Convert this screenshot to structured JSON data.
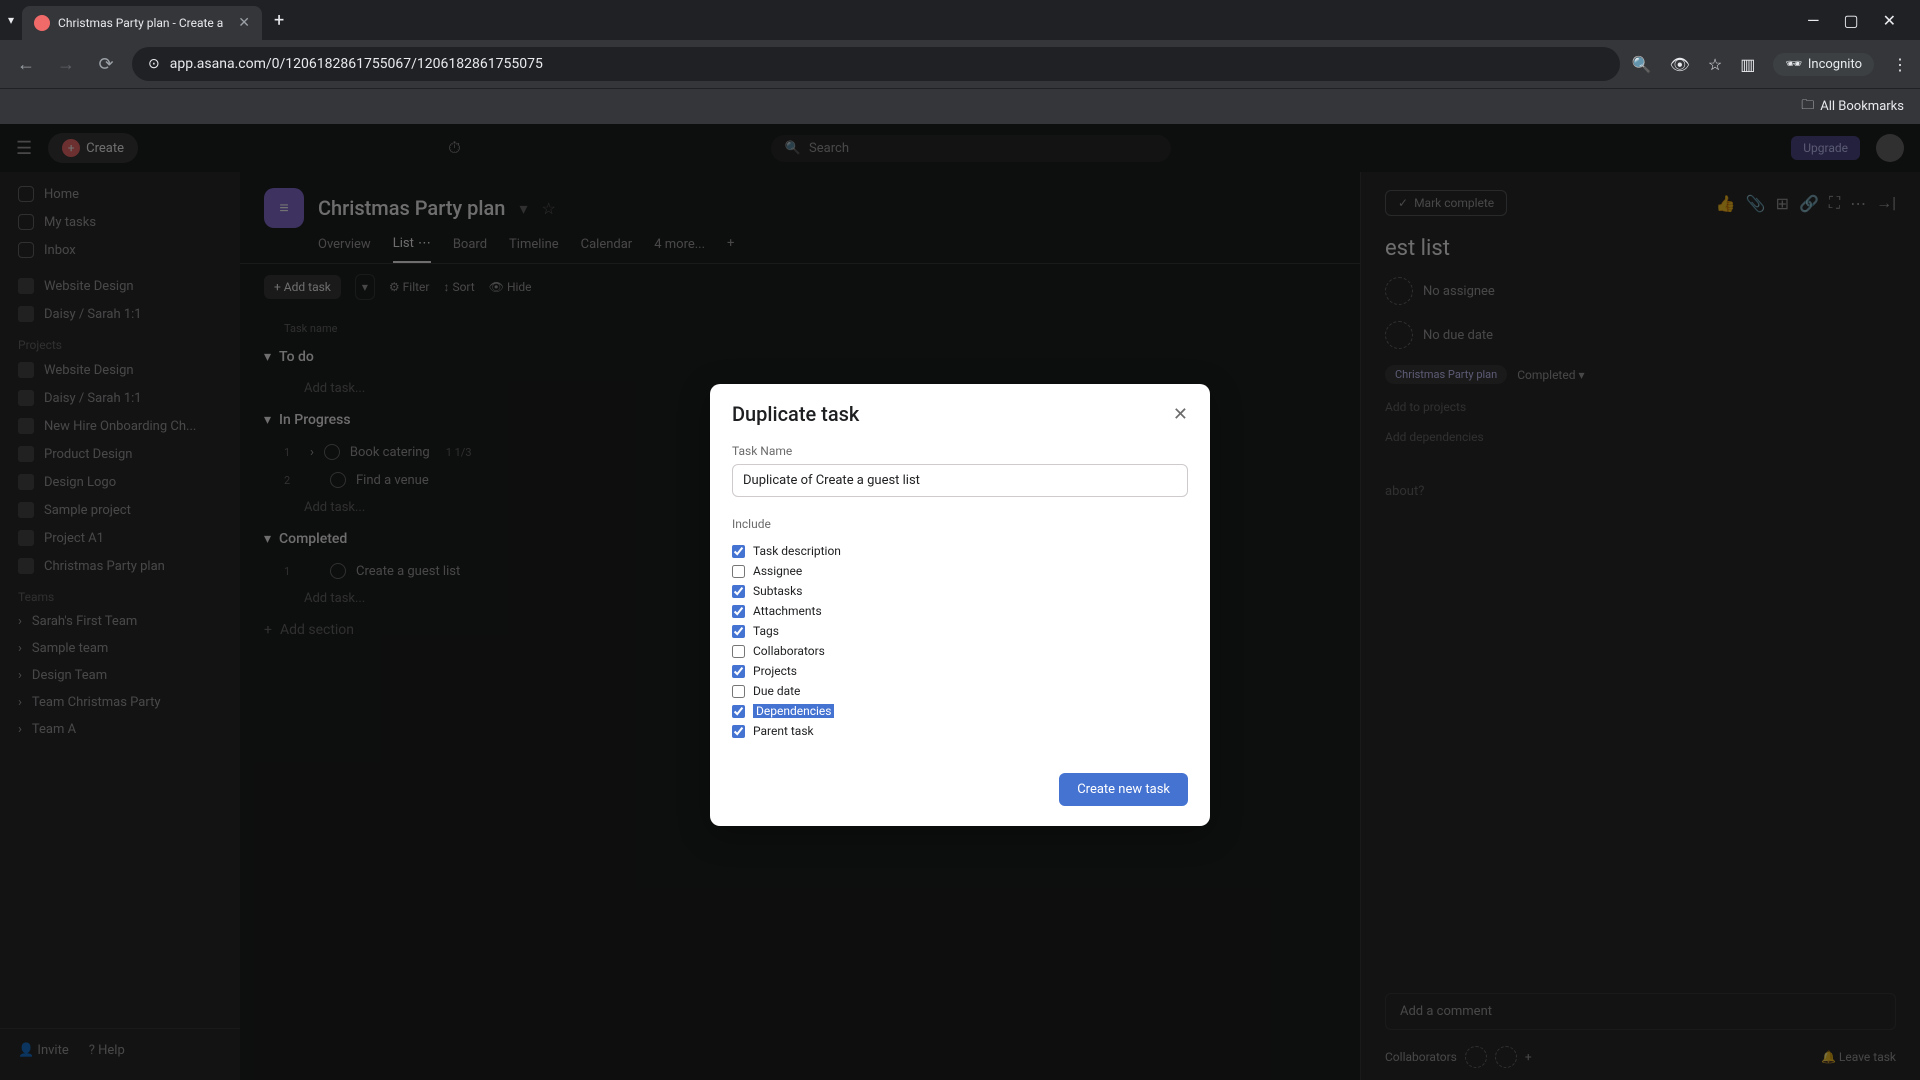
{
  "browser": {
    "tab_title": "Christmas Party plan - Create a",
    "url": "app.asana.com/0/1206182861755067/1206182861755075",
    "incognito": "Incognito",
    "all_bookmarks": "All Bookmarks"
  },
  "topbar": {
    "create": "Create",
    "search": "Search",
    "upgrade": "Upgrade"
  },
  "sidebar": {
    "home": "Home",
    "my_tasks": "My tasks",
    "inbox": "Inbox",
    "recent": [
      "Website Design",
      "Daisy / Sarah 1:1"
    ],
    "projects_label": "Projects",
    "projects": [
      "Website Design",
      "Daisy / Sarah 1:1",
      "New Hire Onboarding Ch...",
      "Product Design",
      "Design Logo",
      "Sample project",
      "Project A1",
      "Christmas Party plan"
    ],
    "teams_label": "Teams",
    "teams": [
      "Sarah's First Team",
      "Sample team",
      "Design Team",
      "Team Christmas Party",
      "Team A"
    ],
    "invite": "Invite",
    "help": "Help"
  },
  "project": {
    "title": "Christmas Party plan",
    "tabs": [
      "Overview",
      "List",
      "Board",
      "Timeline",
      "Calendar",
      "4 more..."
    ],
    "add_task": "Add task",
    "filter": "Filter",
    "sort": "Sort",
    "hide": "Hide",
    "task_name_col": "Task name",
    "sections": {
      "todo": "To do",
      "in_progress": "In Progress",
      "completed": "Completed"
    },
    "tasks": {
      "book_catering": "Book catering",
      "book_catering_meta": "1   1/3",
      "find_venue": "Find a venue",
      "create_guest": "Create a guest list"
    },
    "add_task_ghost": "Add task...",
    "add_section": "Add section"
  },
  "detail": {
    "mark_complete": "Mark complete",
    "title": "est list",
    "no_assignee": "No assignee",
    "no_due_date": "No due date",
    "project_pill": "Christmas Party plan",
    "status": "Completed",
    "add_to_projects": "Add to projects",
    "add_dependencies": "Add dependencies",
    "about_q": "about?",
    "add_comment": "Add a comment",
    "collaborators": "Collaborators",
    "leave_task": "Leave task"
  },
  "modal": {
    "title": "Duplicate task",
    "task_name_label": "Task Name",
    "task_name_value": "Duplicate of Create a guest list",
    "include_label": "Include",
    "options": [
      {
        "label": "Task description",
        "checked": true
      },
      {
        "label": "Assignee",
        "checked": false
      },
      {
        "label": "Subtasks",
        "checked": true
      },
      {
        "label": "Attachments",
        "checked": true
      },
      {
        "label": "Tags",
        "checked": true
      },
      {
        "label": "Collaborators",
        "checked": false
      },
      {
        "label": "Projects",
        "checked": true
      },
      {
        "label": "Due date",
        "checked": false
      },
      {
        "label": "Dependencies",
        "checked": true,
        "selected": true
      },
      {
        "label": "Parent task",
        "checked": true
      }
    ],
    "create_btn": "Create new task"
  }
}
